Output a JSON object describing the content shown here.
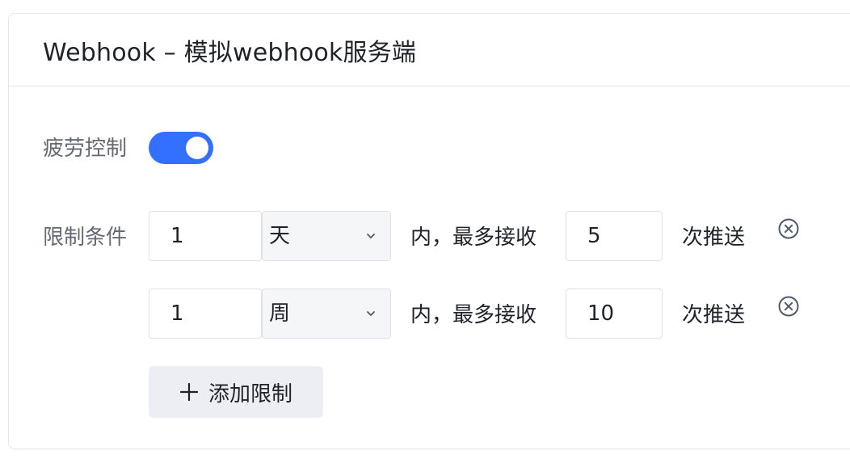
{
  "card": {
    "title": "Webhook – 模拟webhook服务端"
  },
  "fatigue": {
    "label": "疲劳控制",
    "enabled": true
  },
  "limits": {
    "label": "限制条件",
    "rows": [
      {
        "count": "1",
        "unit": "天",
        "mid_text": "内，最多接收",
        "max": "5",
        "suffix": "次推送"
      },
      {
        "count": "1",
        "unit": "周",
        "mid_text": "内，最多接收",
        "max": "10",
        "suffix": "次推送"
      }
    ],
    "add_label": "添加限制"
  },
  "icons": {
    "toggle": "toggle-switch",
    "select": "chevron-down-icon",
    "delete": "close-circle-icon",
    "add": "plus-icon"
  },
  "colors": {
    "accent": "#3370ff",
    "text": "#1f2329",
    "label": "#646a73",
    "border": "#dee0e3"
  }
}
